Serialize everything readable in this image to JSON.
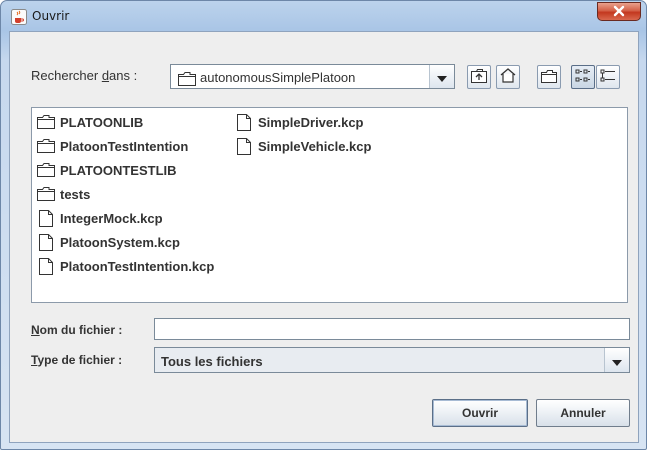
{
  "window": {
    "title": "Ouvrir",
    "icon": "java-cup-icon",
    "close_icon": "close-x-icon"
  },
  "lookin": {
    "label_before": "Rechercher ",
    "label_mnemonic": "d",
    "label_after": "ans :",
    "value": "autonomousSimplePlatoon"
  },
  "toolbar": [
    {
      "name": "up-one-level-button",
      "icon": "up-folder-icon"
    },
    {
      "name": "home-button",
      "icon": "home-icon"
    },
    {
      "name": "new-folder-button",
      "icon": "new-folder-icon"
    },
    {
      "name": "list-view-button",
      "icon": "list-view-icon"
    },
    {
      "name": "details-view-button",
      "icon": "details-view-icon"
    }
  ],
  "files": {
    "col1": [
      {
        "name": "PLATOONLIB",
        "type": "folder"
      },
      {
        "name": "PlatoonTestIntention",
        "type": "folder"
      },
      {
        "name": "PLATOONTESTLIB",
        "type": "folder"
      },
      {
        "name": "tests",
        "type": "folder"
      },
      {
        "name": "IntegerMock.kcp",
        "type": "file"
      },
      {
        "name": "PlatoonSystem.kcp",
        "type": "file"
      },
      {
        "name": "PlatoonTestIntention.kcp",
        "type": "file"
      }
    ],
    "col2": [
      {
        "name": "SimpleDriver.kcp",
        "type": "file"
      },
      {
        "name": "SimpleVehicle.kcp",
        "type": "file"
      }
    ]
  },
  "filename": {
    "label_mnemonic": "N",
    "label_rest": "om du fichier :",
    "value": ""
  },
  "filetype": {
    "label_mnemonic": "T",
    "label_rest": "ype de fichier :",
    "value": "Tous les fichiers"
  },
  "buttons": {
    "open": "Ouvrir",
    "cancel": "Annuler"
  }
}
